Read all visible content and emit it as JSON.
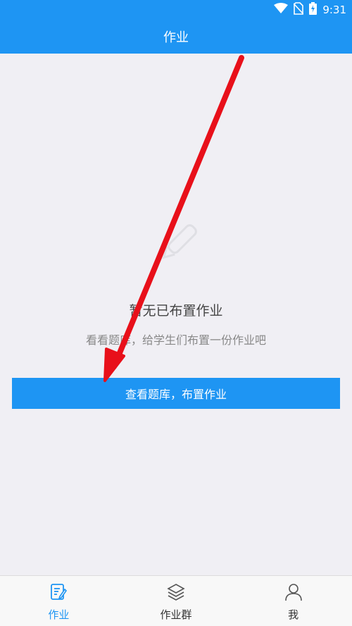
{
  "status_bar": {
    "time": "9:31",
    "icons": [
      "wifi-icon",
      "no-sim-icon",
      "battery-charging-icon"
    ]
  },
  "header": {
    "title": "作业"
  },
  "empty_state": {
    "icon": "pencil-icon",
    "title": "暂无已布置作业",
    "subtitle": "看看题库，给学生们布置一份作业吧",
    "button_label": "查看题库，布置作业"
  },
  "tab_bar": {
    "tabs": [
      {
        "label": "作业",
        "icon": "homework-icon",
        "active": true
      },
      {
        "label": "作业群",
        "icon": "layers-icon",
        "active": false
      },
      {
        "label": "我",
        "icon": "person-icon",
        "active": false
      }
    ]
  },
  "colors": {
    "brand_blue": "#1e95f3",
    "background": "#f0eff4",
    "annotation_red": "#e8101a"
  }
}
